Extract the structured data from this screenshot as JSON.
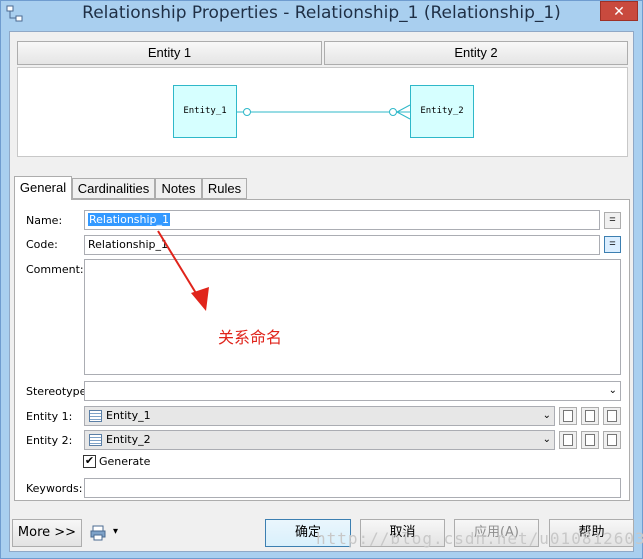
{
  "window": {
    "title": "Relationship Properties - Relationship_1 (Relationship_1)",
    "close_label": "✕"
  },
  "header": {
    "entity1_label": "Entity 1",
    "entity2_label": "Entity 2"
  },
  "diagram": {
    "entity1_name": "Entity_1",
    "entity2_name": "Entity_2",
    "entity_fill": "#d6ffff",
    "entity_border": "#2fb8c9",
    "line_color": "#2fb8c9"
  },
  "tabs": [
    "General",
    "Cardinalities",
    "Notes",
    "Rules"
  ],
  "form": {
    "name_label": "Name:",
    "name_value": "Relationship_1",
    "code_label": "Code:",
    "code_value": "Relationship_1",
    "eq_label": "=",
    "comment_label": "Comment:",
    "comment_value": "",
    "stereotype_label": "Stereotype:",
    "stereotype_value": "",
    "entity1_label": "Entity 1:",
    "entity1_value": "Entity_1",
    "entity2_label": "Entity 2:",
    "entity2_value": "Entity_2",
    "generate_label": "Generate",
    "generate_checked": true,
    "check_mark": "✔",
    "keywords_label": "Keywords:",
    "keywords_value": "",
    "dropdown_caret": "⌄"
  },
  "annotation": {
    "text": "关系命名",
    "color": "#e0241b"
  },
  "footer": {
    "more_label": "More >>",
    "print_caret": "▾",
    "ok_label": "确定",
    "cancel_label": "取消",
    "apply_label": "应用(A)",
    "help_label": "帮助"
  },
  "watermark": "http://blog.csdn.net/u010812603"
}
